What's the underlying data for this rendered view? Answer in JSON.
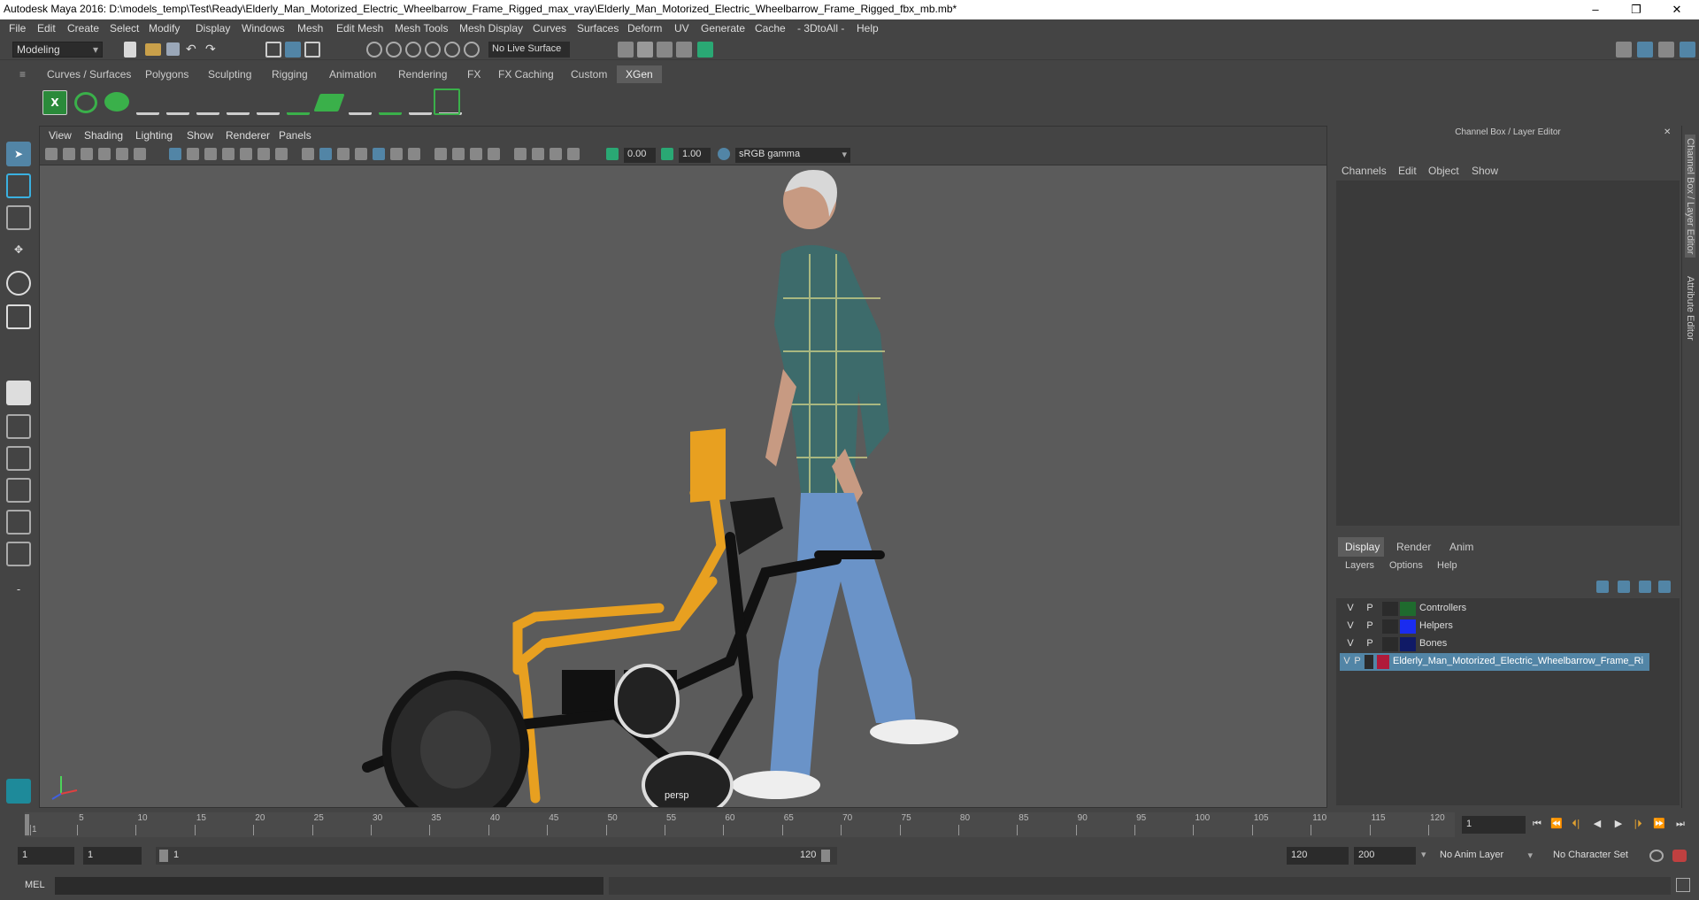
{
  "window": {
    "title": "Autodesk Maya 2016: D:\\models_temp\\Test\\Ready\\Elderly_Man_Motorized_Electric_Wheelbarrow_Frame_Rigged_max_vray\\Elderly_Man_Motorized_Electric_Wheelbarrow_Frame_Rigged_fbx_mb.mb*",
    "controls": [
      "–",
      "❐",
      "✕"
    ]
  },
  "menubar": [
    "File",
    "Edit",
    "Create",
    "Select",
    "Modify",
    "Display",
    "Windows",
    "Mesh",
    "Edit Mesh",
    "Mesh Tools",
    "Mesh Display",
    "Curves",
    "Surfaces",
    "Deform",
    "UV",
    "Generate",
    "Cache",
    "- 3DtoAll -",
    "Help"
  ],
  "statusline": {
    "mode": "Modeling",
    "live_surface": "No Live Surface"
  },
  "shelf_tabs": [
    {
      "label": "Curves / Surfaces",
      "active": false
    },
    {
      "label": "Polygons",
      "active": false
    },
    {
      "label": "Sculpting",
      "active": false
    },
    {
      "label": "Rigging",
      "active": false
    },
    {
      "label": "Animation",
      "active": false
    },
    {
      "label": "Rendering",
      "active": false
    },
    {
      "label": "FX",
      "active": false
    },
    {
      "label": "FX Caching",
      "active": false
    },
    {
      "label": "Custom",
      "active": false
    },
    {
      "label": "XGen",
      "active": true
    }
  ],
  "viewport": {
    "menu": [
      "View",
      "Shading",
      "Lighting",
      "Show",
      "Renderer",
      "Panels"
    ],
    "exposure": "0.00",
    "gamma": "1.00",
    "color_space": "sRGB gamma",
    "camera": "persp"
  },
  "channel_box": {
    "title": "Channel Box / Layer Editor",
    "menu": [
      "Channels",
      "Edit",
      "Object",
      "Show"
    ]
  },
  "layer_editor": {
    "tabs": [
      "Display",
      "Render",
      "Anim"
    ],
    "active_tab": "Display",
    "menu": [
      "Layers",
      "Options",
      "Help"
    ],
    "layers": [
      {
        "v": "V",
        "p": "P",
        "color": "#1f6b2e",
        "name": "Controllers",
        "selected": false
      },
      {
        "v": "V",
        "p": "P",
        "color": "#1a2cf0",
        "name": "Helpers",
        "selected": false
      },
      {
        "v": "V",
        "p": "P",
        "color": "#101a66",
        "name": "Bones",
        "selected": false
      },
      {
        "v": "V",
        "p": "P",
        "color": "#b01a3a",
        "name": "Elderly_Man_Motorized_Electric_Wheelbarrow_Frame_Ri",
        "selected": true
      }
    ]
  },
  "side_tabs": [
    "Channel Box / Layer Editor",
    "Attribute Editor"
  ],
  "timeline": {
    "ticks": [
      "1",
      "5",
      "10",
      "15",
      "20",
      "25",
      "30",
      "35",
      "40",
      "45",
      "50",
      "55",
      "60",
      "65",
      "70",
      "75",
      "80",
      "85",
      "90",
      "95",
      "100",
      "105",
      "110",
      "115",
      "120"
    ],
    "current_frame": "1",
    "playback_buttons": [
      "⏮",
      "⏪",
      "⏴|",
      "◀",
      "▶",
      "|⏵",
      "⏩",
      "⏭"
    ]
  },
  "range": {
    "start": "1",
    "playback_start": "1",
    "slider_start": "1",
    "slider_end": "120",
    "playback_end": "120",
    "end": "200",
    "anim_layer": "No Anim Layer",
    "character_set": "No Character Set"
  },
  "command_line": {
    "label": "MEL"
  },
  "colors": {
    "accent": "#5285a6",
    "frame_yellow": "#e8a020",
    "shirt": "#3d6b6b",
    "jeans": "#6a93c8"
  }
}
